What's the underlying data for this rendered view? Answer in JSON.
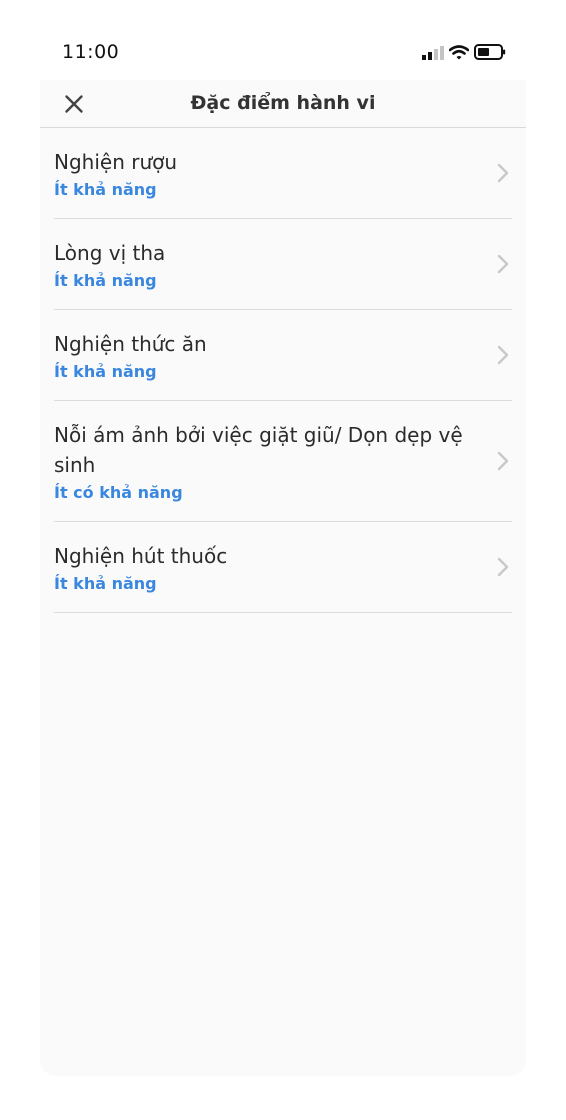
{
  "status_bar": {
    "time": "11:00",
    "icons": [
      "cellular-signal-icon",
      "wifi-icon",
      "battery-icon"
    ]
  },
  "header": {
    "title": "Đặc điểm hành vi",
    "close_icon": "close-icon"
  },
  "items": [
    {
      "title": "Nghiện rượu",
      "subtitle": "Ít khả năng"
    },
    {
      "title": "Lòng vị tha",
      "subtitle": "Ít khả năng"
    },
    {
      "title": "Nghiện thức ăn",
      "subtitle": "Ít khả năng"
    },
    {
      "title": "Nỗi ám ảnh bởi việc giặt giũ/ Dọn dẹp vệ sinh",
      "subtitle": "Ít có khả năng"
    },
    {
      "title": "Nghiện hút thuốc",
      "subtitle": "Ít khả năng"
    }
  ],
  "colors": {
    "accent": "#3a87e0",
    "text": "#2b2b2b",
    "panel_bg": "#fafafa",
    "divider": "#dcdcdc",
    "chevron": "#c8c8c8"
  }
}
